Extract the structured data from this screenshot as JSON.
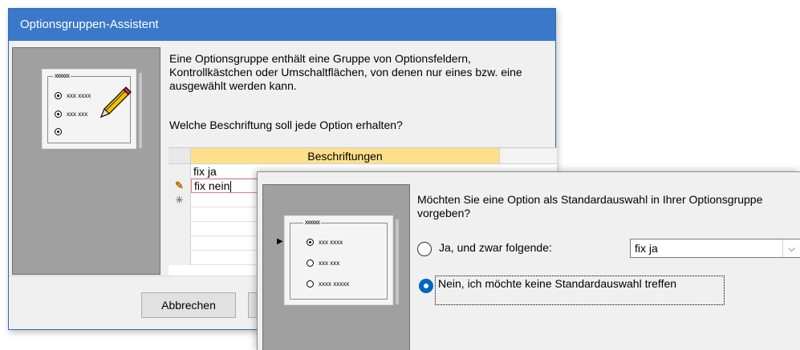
{
  "wizard": {
    "title": "Optionsgruppen-Assistent",
    "description": "Eine Optionsgruppe enthält eine Gruppe von Optionsfeldern, Kontrollkästchen oder Umschaltflächen, von denen nur eines bzw. eine ausgewählt werden kann.",
    "question": "Welche Beschriftung soll jede Option erhalten?",
    "grid": {
      "header": "Beschriftungen",
      "rows": [
        "fix ja",
        "fix nein"
      ],
      "edit_marker": "✎",
      "new_marker": "✳"
    },
    "preview": {
      "group_label": "xxxxxx",
      "options": [
        "xxx xxxx",
        "xxx xxx",
        ""
      ]
    },
    "buttons": {
      "cancel": "Abbrechen"
    }
  },
  "default_dialog": {
    "question": "Möchten Sie eine Option als Standardauswahl in Ihrer Optionsgruppe vorgeben?",
    "option_yes": "Ja, und zwar folgende:",
    "option_no": "Nein, ich möchte keine Standardauswahl treffen",
    "combo_value": "fix ja",
    "combo_arrow": "⌵",
    "selected_option": "no",
    "preview": {
      "group_label": "xxxxxx",
      "options": [
        "xxx xxxx",
        "xxx xxx",
        "xxxx xxxxx"
      ],
      "pointer": "▶"
    }
  },
  "colors": {
    "titlebar": "#3b78c9",
    "header_highlight": "#ffe08a",
    "active_cell_border": "#e37b8b",
    "radio_selected": "#0067c0"
  }
}
